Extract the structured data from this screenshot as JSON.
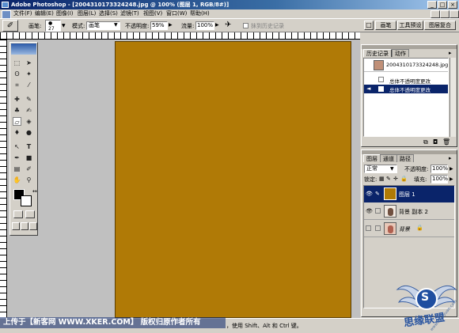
{
  "window": {
    "title": "Adobe Photoshop - [2004310173324248.jpg @ 100% (图层 1, RGB/8#)]",
    "controls": [
      "_",
      "□",
      "×"
    ]
  },
  "menubar": {
    "items": [
      "文件(F)",
      "编辑(E)",
      "图像(I)",
      "图层(L)",
      "选择(S)",
      "滤镜(T)",
      "视图(V)",
      "窗口(W)",
      "帮助(H)"
    ]
  },
  "options_bar": {
    "brush_label": "画笔:",
    "brush_size": "27",
    "mode_label": "模式:",
    "mode_value": "画笔",
    "opacity_label": "不透明度:",
    "opacity_value": "59%",
    "flow_label": "流量:",
    "flow_value": "100%",
    "history_check_label": "抹到历史记录",
    "dock_tabs": [
      "画笔",
      "工具预设",
      "图层复合"
    ]
  },
  "colors": {
    "canvas": "#b07a06",
    "highlight": "#0a246a",
    "workspace": "#c0c0c0"
  },
  "history_panel": {
    "tabs": [
      "历史记录",
      "动作"
    ],
    "snapshot_name": "2004310173324248.jpg",
    "items": [
      "总体不透明度更改",
      "总体不透明度更改"
    ],
    "selected_index": 1
  },
  "layers_panel": {
    "tabs": [
      "图层",
      "通道",
      "路径"
    ],
    "blend_mode": "正常",
    "opacity_label": "不透明度:",
    "opacity_value": "100%",
    "lock_label": "锁定:",
    "fill_label": "填充:",
    "fill_value": "100%",
    "layers": [
      {
        "name": "图层 1",
        "selected": true
      },
      {
        "name": "背景 副本 2",
        "selected": false
      },
      {
        "name": "背景",
        "selected": false
      }
    ]
  },
  "status_bar": {
    "text": "，使用 Shift、Alt 和 Ctrl 键。"
  },
  "watermark": {
    "text": "上传于【新客网 WWW.XKER.COM】 版权归原作者所有"
  },
  "logo": {
    "letter": "S",
    "text": "思缘联盟",
    "sub": "www.missyuan.com"
  }
}
